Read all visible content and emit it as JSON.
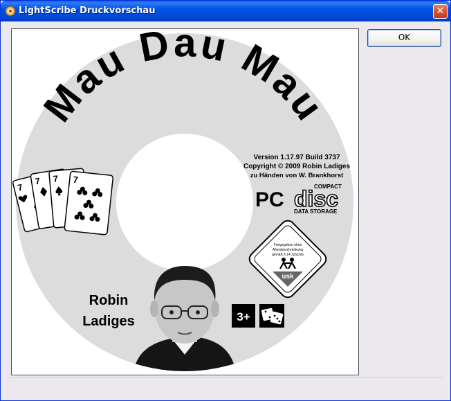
{
  "window": {
    "title": "LightScribe Druckvorschau",
    "close_glyph": "✕"
  },
  "buttons": {
    "ok_label": "OK"
  },
  "disc": {
    "title": "Mau Dau Mau",
    "version": "Version 1.17.97 Build 3737",
    "copyright": "Copyright © 2009 Robin Ladiges",
    "dedication": "zu Händen von W. Brankhorst",
    "pc_label": "PC",
    "cd_logo_top": "COMPACT",
    "cd_logo_main": "disc",
    "cd_logo_bottom": "DATA STORAGE",
    "usk_line1": "Freigegeben ohne",
    "usk_line2": "Altersbeschränkung",
    "usk_line3": "gemäß § 14 JuSchG",
    "usk_label": "usk",
    "author_line1": "Robin",
    "author_line2": "Ladiges",
    "age_rating": "3+",
    "card_rank": "7"
  },
  "icons": {
    "title_icon": "lightscribe-disc-icon",
    "close": "close-icon",
    "dice": "dice-icon"
  },
  "colors": {
    "titlebar": "#0054e3",
    "disc_fill": "#dcdcdc",
    "usk_green": "#55a02c"
  }
}
